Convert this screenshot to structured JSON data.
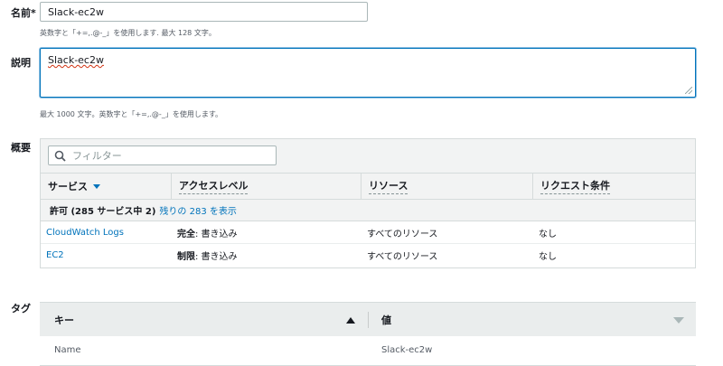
{
  "name": {
    "label": "名前*",
    "value": "Slack-ec2w",
    "hint": "英数字と「+=,.@-_」を使用します. 最大 128 文字。"
  },
  "description": {
    "label": "説明",
    "value": "Slack-ec2w",
    "hint": "最大 1000 文字。英数字と「+=,.@-_」を使用します。"
  },
  "summary": {
    "label": "概要",
    "filter_placeholder": "フィルター",
    "columns": [
      "サービス",
      "アクセスレベル",
      "リソース",
      "リクエスト条件"
    ],
    "allow_text": "許可 (285 サービス中 2)",
    "show_rest_link": "残りの 283 を表示",
    "rows": [
      {
        "service": "CloudWatch Logs",
        "level_bold": "完全",
        "level_rest": ": 書き込み",
        "resource": "すべてのリソース",
        "condition": "なし"
      },
      {
        "service": "EC2",
        "level_bold": "制限",
        "level_rest": ": 書き込み",
        "resource": "すべてのリソース",
        "condition": "なし"
      }
    ]
  },
  "tags": {
    "label": "タグ",
    "columns": [
      "キー",
      "値"
    ],
    "rows": [
      {
        "key": "Name",
        "value": "Slack-ec2w"
      }
    ]
  },
  "colors": {
    "accent": "#0073bb",
    "header_bg": "#f2f3f3"
  }
}
